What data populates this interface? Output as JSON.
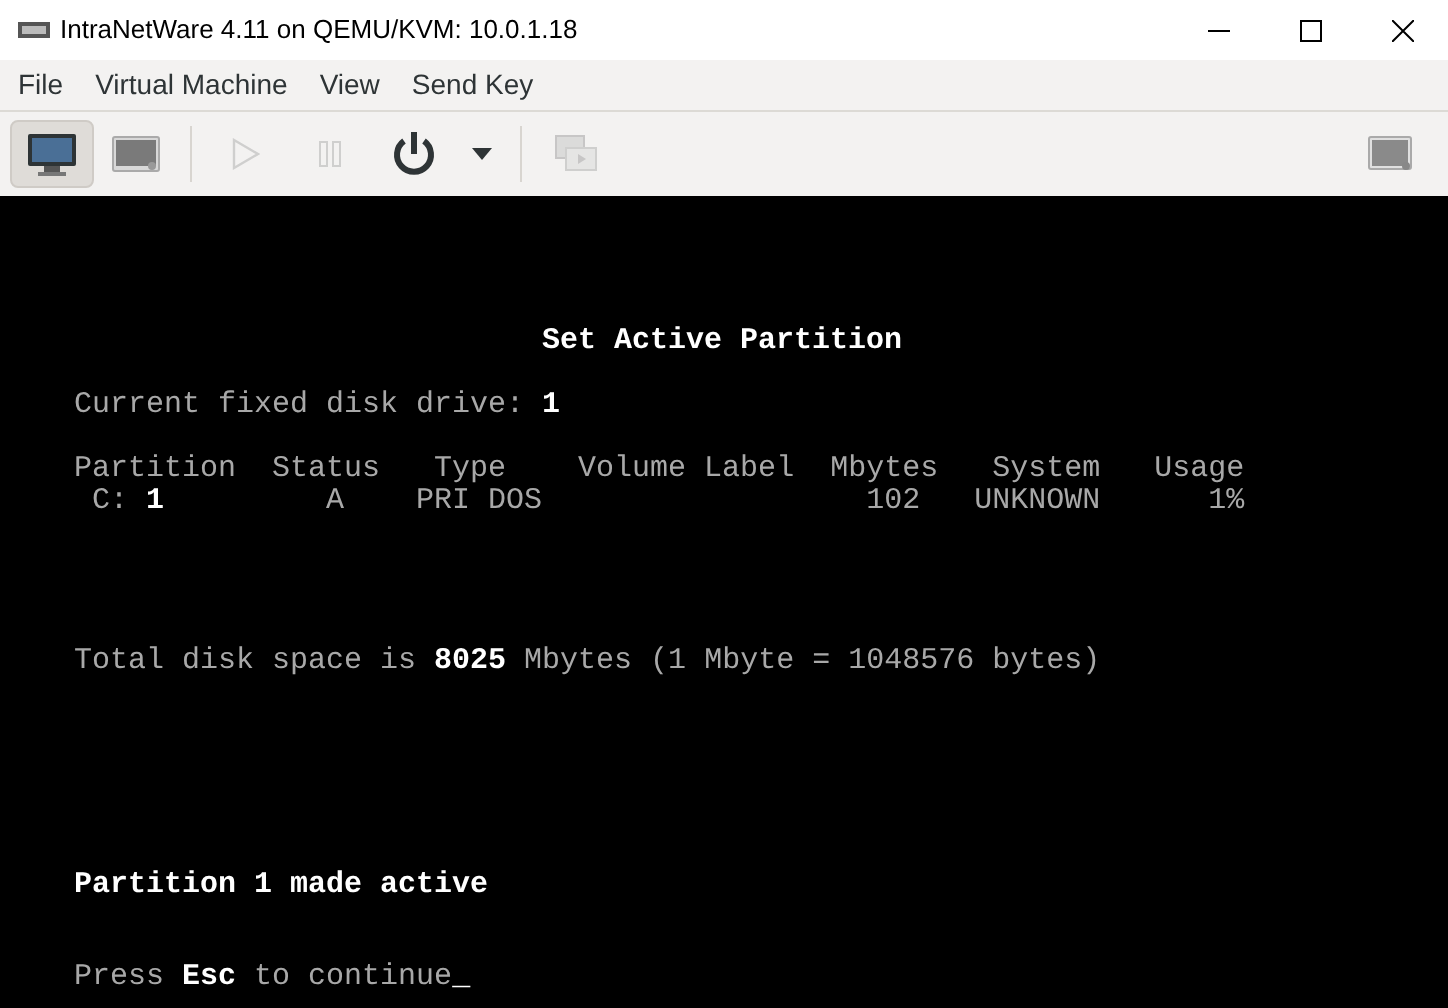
{
  "window": {
    "title": "IntraNetWare 4.11 on QEMU/KVM: 10.0.1.18"
  },
  "menu": [
    "File",
    "Virtual Machine",
    "View",
    "Send Key"
  ],
  "view_buttons": [
    {
      "kind": "console",
      "selected": true
    },
    {
      "kind": "details",
      "selected": false
    }
  ],
  "toolbar": [
    {
      "kind": "run",
      "disabled": true
    },
    {
      "kind": "pause",
      "disabled": true
    },
    {
      "kind": "power",
      "disabled": false
    },
    {
      "kind": "power-menu",
      "disabled": false
    },
    {
      "kind": "snapshots",
      "disabled": true
    },
    {
      "kind": "fullscreen",
      "disabled": false
    }
  ],
  "console": {
    "title": "Set Active Partition",
    "drive_line": "Current fixed disk drive: **1**",
    "table": {
      "columns": [
        "Partition",
        "Status",
        "Type",
        "Volume Label",
        "Mbytes",
        "System",
        "Usage"
      ],
      "rows": [
        [
          "C: **1**",
          "A",
          "PRI DOS",
          "",
          "102",
          "UNKNOWN",
          "1%"
        ]
      ]
    },
    "total_line": "Total disk space is **8025** Mbytes (1 Mbyte = 1048576 bytes)",
    "message": "Partition 1 made active",
    "prompt": "Press **Esc** to continue",
    "cursor": "_"
  }
}
